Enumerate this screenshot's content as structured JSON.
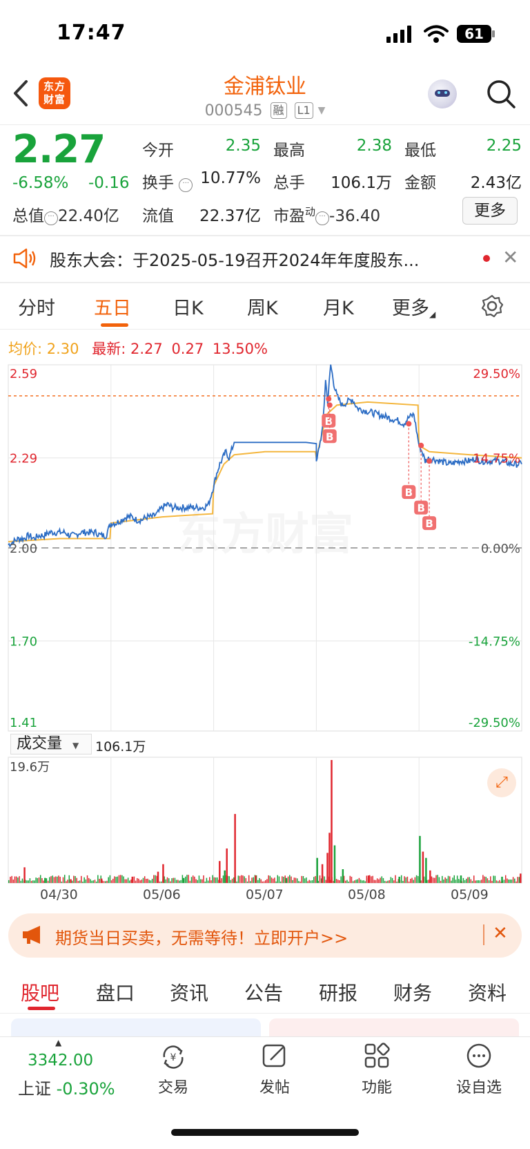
{
  "status_bar": {
    "time": "17:47",
    "battery": "61"
  },
  "header": {
    "logo_text_line1": "东方",
    "logo_text_line2": "财富",
    "stock_name": "金浦钛业",
    "stock_code": "000545",
    "tag_margin": "融",
    "tag_level": "L1"
  },
  "quote": {
    "price": "2.27",
    "change_pct": "-6.58%",
    "change_abs": "-0.16",
    "fields": {
      "open_label": "今开",
      "open": "2.35",
      "high_label": "最高",
      "high": "2.38",
      "low_label": "最低",
      "low": "2.25",
      "turnover_label": "换手",
      "turnover": "10.77%",
      "volume_label": "总手",
      "volume": "106.1万",
      "amount_label": "金额",
      "amount": "2.43亿",
      "mktcap_label": "总值",
      "mktcap": "22.40亿",
      "float_label": "流值",
      "float": "22.37亿",
      "pe_label": "市盈",
      "pe_sup": "动",
      "pe": "-36.40"
    },
    "more_label": "更多"
  },
  "notice": {
    "text": "股东大会：于2025-05-19召开2024年年度股东..."
  },
  "period_tabs": [
    "分时",
    "五日",
    "日K",
    "周K",
    "月K",
    "更多"
  ],
  "active_tab": "五日",
  "legend": {
    "avg_label": "均价:",
    "avg": "2.30",
    "latest_label": "最新:",
    "latest": "2.27",
    "change": "0.27",
    "change_pct": "13.50%"
  },
  "watermark": "东方财富",
  "volume_panel": {
    "selector_label": "成交量",
    "total": "106.1万",
    "max_label": "19.6万"
  },
  "promo": {
    "text": "期货当日买卖，无需等待！立即开户>>"
  },
  "bottom_tabs": [
    "股吧",
    "盘口",
    "资讯",
    "公告",
    "研报",
    "财务",
    "资料"
  ],
  "bottom_nav": {
    "index_value": "3342.00",
    "index_name": "上证",
    "index_change": "-0.30%",
    "items": [
      "交易",
      "发帖",
      "功能",
      "设自选"
    ]
  },
  "colors": {
    "accent": "#f2620b",
    "up": "#e0262e",
    "down": "#19a33b",
    "price_line": "#2b6cc4",
    "avg_line": "#f4b63d"
  },
  "chart_data": {
    "type": "line",
    "title": "",
    "xlabel": "",
    "ylabel": "",
    "categories": [
      "04/30",
      "05/06",
      "05/07",
      "05/08",
      "05/09"
    ],
    "y_ticks_left": [
      "2.59",
      "2.29",
      "2.00",
      "1.70",
      "1.41"
    ],
    "y_ticks_right": [
      "29.50%",
      "14.75%",
      "0.00%",
      "-14.75%",
      "-29.50%"
    ],
    "ylim": [
      1.41,
      2.59
    ],
    "prev_close": 2.0,
    "series": [
      {
        "values": [
          [
            0.0,
            2.01
          ],
          [
            0.05,
            2.02
          ],
          [
            0.1,
            2.03
          ],
          [
            0.15,
            2.03
          ],
          [
            0.2,
            2.04
          ],
          [
            0.25,
            2.03
          ],
          [
            0.3,
            2.04
          ],
          [
            0.35,
            2.04
          ],
          [
            0.4,
            2.05
          ],
          [
            0.45,
            2.05
          ],
          [
            0.5,
            2.05
          ],
          [
            0.55,
            2.05
          ],
          [
            0.6,
            2.04
          ],
          [
            0.65,
            2.04
          ],
          [
            0.7,
            2.05
          ],
          [
            0.75,
            2.05
          ],
          [
            0.8,
            2.05
          ],
          [
            0.85,
            2.05
          ],
          [
            0.9,
            2.04
          ],
          [
            0.95,
            2.04
          ],
          [
            1.0,
            2.08
          ],
          [
            1.05,
            2.08
          ],
          [
            1.1,
            2.09
          ],
          [
            1.15,
            2.1
          ],
          [
            1.2,
            2.1
          ],
          [
            1.25,
            2.09
          ],
          [
            1.3,
            2.09
          ],
          [
            1.35,
            2.1
          ],
          [
            1.4,
            2.1
          ],
          [
            1.45,
            2.11
          ],
          [
            1.5,
            2.13
          ],
          [
            1.55,
            2.14
          ],
          [
            1.6,
            2.13
          ],
          [
            1.65,
            2.13
          ],
          [
            1.7,
            2.13
          ],
          [
            1.75,
            2.13
          ],
          [
            1.8,
            2.13
          ],
          [
            1.85,
            2.13
          ],
          [
            1.9,
            2.13
          ],
          [
            1.95,
            2.14
          ],
          [
            2.0,
            2.2
          ],
          [
            2.03,
            2.24
          ],
          [
            2.06,
            2.27
          ],
          [
            2.09,
            2.29
          ],
          [
            2.12,
            2.31
          ],
          [
            2.15,
            2.29
          ],
          [
            2.2,
            2.34
          ],
          [
            2.25,
            2.34
          ],
          [
            2.4,
            2.34
          ],
          [
            2.6,
            2.34
          ],
          [
            2.8,
            2.34
          ],
          [
            3.0,
            2.34
          ],
          [
            3.0,
            2.27
          ],
          [
            3.03,
            2.33
          ],
          [
            3.06,
            2.38
          ],
          [
            3.09,
            2.54
          ],
          [
            3.11,
            2.47
          ],
          [
            3.14,
            2.59
          ],
          [
            3.17,
            2.53
          ],
          [
            3.2,
            2.49
          ],
          [
            3.25,
            2.46
          ],
          [
            3.3,
            2.47
          ],
          [
            3.35,
            2.48
          ],
          [
            3.4,
            2.45
          ],
          [
            3.5,
            2.44
          ],
          [
            3.6,
            2.43
          ],
          [
            3.7,
            2.42
          ],
          [
            3.8,
            2.41
          ],
          [
            3.85,
            2.4
          ],
          [
            3.9,
            2.42
          ],
          [
            3.95,
            2.43
          ],
          [
            4.0,
            2.33
          ],
          [
            4.03,
            2.31
          ],
          [
            4.06,
            2.28
          ],
          [
            4.1,
            2.29
          ],
          [
            4.2,
            2.28
          ],
          [
            4.3,
            2.27
          ],
          [
            4.4,
            2.28
          ],
          [
            4.5,
            2.28
          ],
          [
            4.55,
            2.29
          ],
          [
            4.6,
            2.28
          ],
          [
            4.7,
            2.28
          ],
          [
            4.8,
            2.28
          ],
          [
            4.9,
            2.27
          ],
          [
            5.0,
            2.27
          ]
        ]
      },
      {
        "values": [
          [
            0.0,
            2.02
          ],
          [
            0.5,
            2.03
          ],
          [
            0.99,
            2.03
          ],
          [
            1.0,
            2.08
          ],
          [
            1.5,
            2.1
          ],
          [
            1.99,
            2.11
          ],
          [
            2.0,
            2.2
          ],
          [
            2.1,
            2.27
          ],
          [
            2.2,
            2.3
          ],
          [
            2.5,
            2.31
          ],
          [
            2.99,
            2.31
          ],
          [
            3.0,
            2.29
          ],
          [
            3.1,
            2.43
          ],
          [
            3.2,
            2.46
          ],
          [
            3.5,
            2.47
          ],
          [
            3.99,
            2.46
          ],
          [
            4.0,
            2.33
          ],
          [
            4.1,
            2.31
          ],
          [
            4.5,
            2.3
          ],
          [
            5.0,
            2.29
          ]
        ]
      }
    ],
    "markers": [
      {
        "x": 3.12,
        "y": 2.48,
        "label": "B"
      },
      {
        "x": 3.13,
        "y": 2.46,
        "label": "B"
      },
      {
        "x": 3.9,
        "y": 2.4,
        "label": "B"
      },
      {
        "x": 4.02,
        "y": 2.33,
        "label": "B"
      },
      {
        "x": 4.1,
        "y": 2.28,
        "label": "B"
      }
    ],
    "volume": {
      "ylim": [
        0,
        196000
      ],
      "bars": [
        [
          0.15,
          25000,
          "red"
        ],
        [
          0.35,
          8000,
          "green"
        ],
        [
          0.6,
          6000,
          "red"
        ],
        [
          0.9,
          7000,
          "red"
        ],
        [
          1.2,
          10000,
          "red"
        ],
        [
          1.45,
          18000,
          "red"
        ],
        [
          1.5,
          30000,
          "red"
        ],
        [
          1.7,
          8000,
          "green"
        ],
        [
          2.05,
          35000,
          "red"
        ],
        [
          2.1,
          20000,
          "green"
        ],
        [
          2.12,
          55000,
          "red"
        ],
        [
          2.2,
          110000,
          "red"
        ],
        [
          2.4,
          12000,
          "red"
        ],
        [
          2.7,
          8000,
          "green"
        ],
        [
          3.0,
          40000,
          "green"
        ],
        [
          3.05,
          30000,
          "red"
        ],
        [
          3.1,
          48000,
          "red"
        ],
        [
          3.12,
          80000,
          "red"
        ],
        [
          3.14,
          196000,
          "red"
        ],
        [
          3.17,
          60000,
          "green"
        ],
        [
          3.25,
          22000,
          "green"
        ],
        [
          3.5,
          12000,
          "red"
        ],
        [
          3.8,
          10000,
          "green"
        ],
        [
          4.0,
          75000,
          "green"
        ],
        [
          4.03,
          50000,
          "red"
        ],
        [
          4.06,
          40000,
          "green"
        ],
        [
          4.1,
          20000,
          "red"
        ],
        [
          4.4,
          12000,
          "green"
        ],
        [
          4.8,
          10000,
          "green"
        ],
        [
          4.98,
          15000,
          "red"
        ]
      ]
    }
  }
}
